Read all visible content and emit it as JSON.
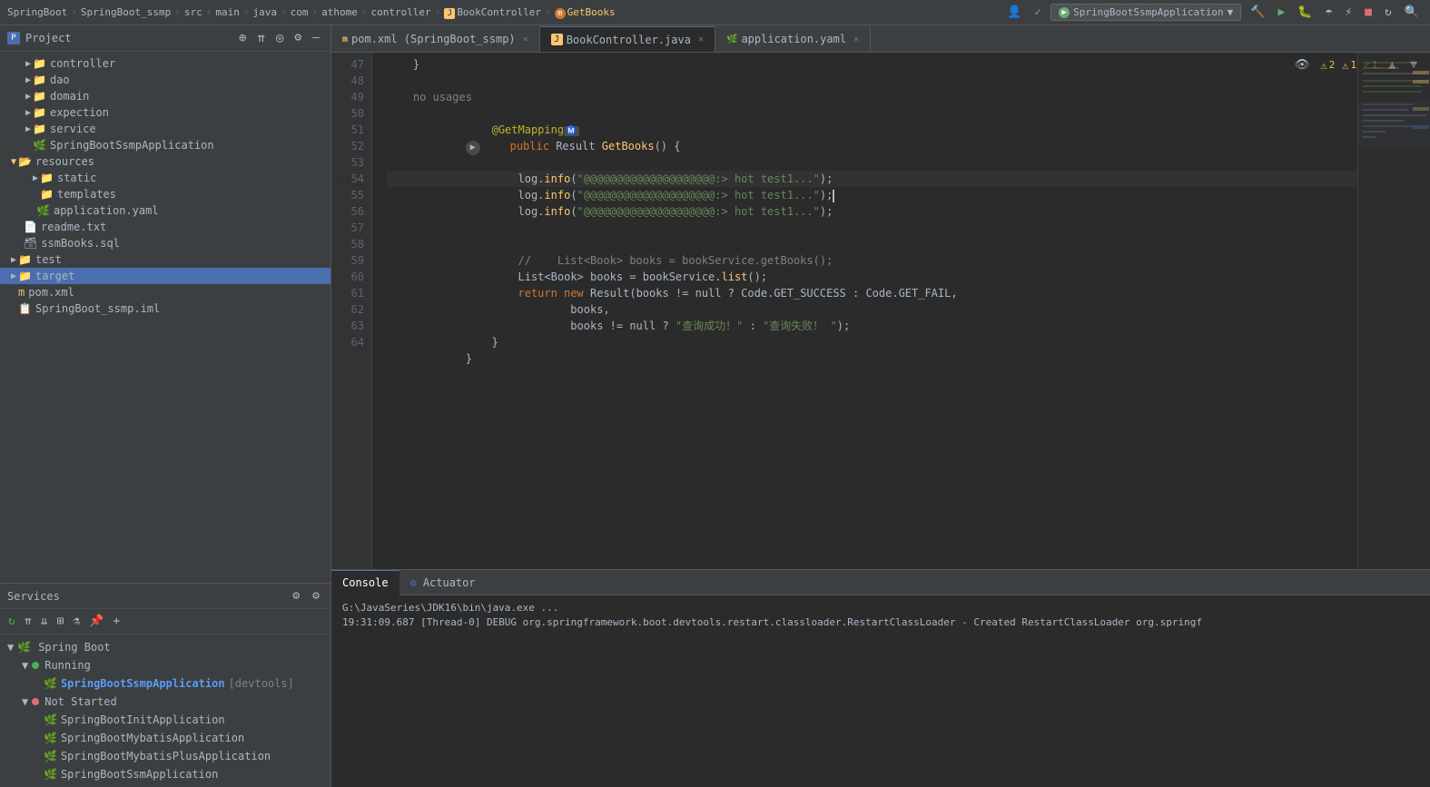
{
  "topbar": {
    "breadcrumb": [
      {
        "label": "SpringBoot",
        "active": false
      },
      {
        "label": "SpringBoot_ssmp",
        "active": false
      },
      {
        "label": "src",
        "active": false
      },
      {
        "label": "main",
        "active": false
      },
      {
        "label": "java",
        "active": false
      },
      {
        "label": "com",
        "active": false
      },
      {
        "label": "athome",
        "active": false
      },
      {
        "label": "controller",
        "active": false
      },
      {
        "label": "BookController",
        "active": false
      },
      {
        "label": "GetBooks",
        "active": true
      }
    ],
    "run_config": "SpringBootSsmpApplication",
    "icons": [
      "hammer",
      "play",
      "debug",
      "coverage",
      "run-configs",
      "search"
    ]
  },
  "sidebar": {
    "title": "Project",
    "tree": [
      {
        "indent": 0,
        "type": "folder",
        "name": "controller",
        "expanded": false
      },
      {
        "indent": 0,
        "type": "folder",
        "name": "dao",
        "expanded": false
      },
      {
        "indent": 0,
        "type": "folder",
        "name": "domain",
        "expanded": false
      },
      {
        "indent": 0,
        "type": "folder",
        "name": "expection",
        "expanded": false
      },
      {
        "indent": 0,
        "type": "folder",
        "name": "service",
        "expanded": false
      },
      {
        "indent": 0,
        "type": "spring",
        "name": "SpringBootSsmpApplication",
        "expanded": false
      },
      {
        "indent": -1,
        "type": "folder-open",
        "name": "resources",
        "expanded": true
      },
      {
        "indent": 0,
        "type": "folder",
        "name": "static",
        "expanded": false
      },
      {
        "indent": 0,
        "type": "folder",
        "name": "templates",
        "expanded": false
      },
      {
        "indent": 0,
        "type": "yaml",
        "name": "application.yaml",
        "expanded": false
      },
      {
        "indent": -1,
        "type": "txt",
        "name": "readme.txt",
        "expanded": false
      },
      {
        "indent": -1,
        "type": "sql",
        "name": "ssmBooks.sql",
        "expanded": false
      },
      {
        "indent": -2,
        "type": "folder",
        "name": "test",
        "expanded": false
      },
      {
        "indent": -2,
        "type": "folder",
        "name": "target",
        "expanded": false,
        "selected": true
      },
      {
        "indent": -2,
        "type": "xml",
        "name": "pom.xml",
        "expanded": false
      },
      {
        "indent": -2,
        "type": "iml",
        "name": "SpringBoot_ssmp.iml",
        "expanded": false
      }
    ]
  },
  "tabs": [
    {
      "label": "pom.xml",
      "icon": "xml",
      "active": false,
      "closable": true,
      "path": "SpringBoot_ssmp"
    },
    {
      "label": "BookController.java",
      "icon": "java",
      "active": true,
      "closable": true,
      "path": ""
    },
    {
      "label": "application.yaml",
      "icon": "yaml",
      "active": false,
      "closable": true,
      "path": ""
    }
  ],
  "editor": {
    "lines": [
      {
        "num": 47,
        "content": "    }",
        "tokens": [
          {
            "text": "    }",
            "cls": "plain"
          }
        ]
      },
      {
        "num": 48,
        "content": "",
        "tokens": []
      },
      {
        "num": 49,
        "content": "    no usages",
        "tokens": [
          {
            "text": "    no usages",
            "cls": "comment"
          }
        ]
      },
      {
        "num": 50,
        "content": "    @GetMappingⓂ️",
        "tokens": [
          {
            "text": "    ",
            "cls": "plain"
          },
          {
            "text": "@GetMapping",
            "cls": "annotation"
          },
          {
            "text": "Ⓜ️",
            "cls": "plain"
          }
        ]
      },
      {
        "num": 51,
        "content": "    public Result GetBooks() {",
        "tokens": [
          {
            "text": "    ",
            "cls": "plain"
          },
          {
            "text": "public",
            "cls": "kw"
          },
          {
            "text": " Result ",
            "cls": "plain"
          },
          {
            "text": "GetBooks",
            "cls": "fn"
          },
          {
            "text": "() {",
            "cls": "plain"
          }
        ]
      },
      {
        "num": 52,
        "content": "",
        "tokens": []
      },
      {
        "num": 53,
        "content": "        log.info(\"@@@@@@@@@@@@@@@@@@@@:> hot test1...\");",
        "tokens": [
          {
            "text": "        log.",
            "cls": "plain"
          },
          {
            "text": "info",
            "cls": "method"
          },
          {
            "text": "(",
            "cls": "plain"
          },
          {
            "text": "\"@@@@@@@@@@@@@@@@@@@@:> hot test1...\"",
            "cls": "str"
          },
          {
            "text": ");",
            "cls": "plain"
          }
        ]
      },
      {
        "num": 54,
        "content": "        log.info(\"@@@@@@@@@@@@@@@@@@@@:> hot test1...\");",
        "tokens": [
          {
            "text": "        log.",
            "cls": "plain"
          },
          {
            "text": "info",
            "cls": "method"
          },
          {
            "text": "(",
            "cls": "plain"
          },
          {
            "text": "\"@@@@@@@@@@@@@@@@@@@@:> hot test1...\"",
            "cls": "str"
          },
          {
            "text": ");",
            "cls": "plain"
          }
        ],
        "current": true
      },
      {
        "num": 55,
        "content": "        log.info(\"@@@@@@@@@@@@@@@@@@@@:> hot test1...\");",
        "tokens": [
          {
            "text": "        log.",
            "cls": "plain"
          },
          {
            "text": "info",
            "cls": "method"
          },
          {
            "text": "(",
            "cls": "plain"
          },
          {
            "text": "\"@@@@@@@@@@@@@@@@@@@@:> hot test1...\"",
            "cls": "str"
          },
          {
            "text": ");",
            "cls": "plain"
          }
        ]
      },
      {
        "num": 56,
        "content": "",
        "tokens": []
      },
      {
        "num": 57,
        "content": "",
        "tokens": []
      },
      {
        "num": 58,
        "content": "        //    List<Book> books = bookService.getBooks();",
        "tokens": [
          {
            "text": "        //    List<Book> books = bookService.getBooks();",
            "cls": "comment"
          }
        ]
      },
      {
        "num": 59,
        "content": "        List<Book> books = bookService.list();",
        "tokens": [
          {
            "text": "        ",
            "cls": "plain"
          },
          {
            "text": "List",
            "cls": "type"
          },
          {
            "text": "<",
            "cls": "plain"
          },
          {
            "text": "Book",
            "cls": "type"
          },
          {
            "text": "> books = bookService.",
            "cls": "plain"
          },
          {
            "text": "list",
            "cls": "method"
          },
          {
            "text": "();",
            "cls": "plain"
          }
        ]
      },
      {
        "num": 60,
        "content": "        return new Result(books != null ? Code.GET_SUCCESS : Code.GET_FAIL,",
        "tokens": [
          {
            "text": "        ",
            "cls": "plain"
          },
          {
            "text": "return",
            "cls": "kw"
          },
          {
            "text": " ",
            "cls": "plain"
          },
          {
            "text": "new",
            "cls": "kw"
          },
          {
            "text": " Result(books != null ? Code.",
            "cls": "plain"
          },
          {
            "text": "GET_SUCCESS",
            "cls": "plain"
          },
          {
            "text": " : Code.",
            "cls": "plain"
          },
          {
            "text": "GET_FAIL",
            "cls": "plain"
          },
          {
            "text": ",",
            "cls": "plain"
          }
        ]
      },
      {
        "num": 61,
        "content": "                books,",
        "tokens": [
          {
            "text": "                books,",
            "cls": "plain"
          }
        ]
      },
      {
        "num": 62,
        "content": "                books != null ? \"查询成功！\" : \"查询失败！ \");",
        "tokens": [
          {
            "text": "                books != null ? ",
            "cls": "plain"
          },
          {
            "text": "\"查询成功！\"",
            "cls": "str"
          },
          {
            "text": " : ",
            "cls": "plain"
          },
          {
            "text": "\"查询失败！ \"",
            "cls": "str"
          },
          {
            "text": ");",
            "cls": "plain"
          }
        ]
      },
      {
        "num": 63,
        "content": "    }",
        "tokens": [
          {
            "text": "    }",
            "cls": "plain"
          }
        ]
      },
      {
        "num": 64,
        "content": "}",
        "tokens": [
          {
            "text": "}",
            "cls": "plain"
          }
        ]
      }
    ],
    "warnings": 2,
    "errors": 1,
    "ok": 1
  },
  "services": {
    "title": "Services",
    "groups": [
      {
        "name": "Spring Boot",
        "expanded": true,
        "items": [
          {
            "name": "Running",
            "expanded": true,
            "status": "running",
            "apps": [
              {
                "name": "SpringBootSsmpApplication",
                "tag": "[devtools]",
                "highlighted": true
              }
            ]
          },
          {
            "name": "Not Started",
            "expanded": true,
            "status": "stopped",
            "apps": [
              {
                "name": "SpringBootInitApplication"
              },
              {
                "name": "SpringBootMybatisApplication"
              },
              {
                "name": "SpringBootMybatisPlusApplication"
              },
              {
                "name": "SpringBootSsmApplication"
              }
            ]
          }
        ]
      }
    ],
    "toolbar_icons": [
      "refresh",
      "collapse-all",
      "expand-all",
      "group",
      "filter",
      "pin",
      "add"
    ]
  },
  "console": {
    "tabs": [
      {
        "label": "Console",
        "active": true
      },
      {
        "label": "Actuator",
        "active": false
      }
    ],
    "lines": [
      {
        "text": "G:\\JavaSeries\\JDK16\\bin\\java.exe ...",
        "cls": "console-path"
      },
      {
        "text": "19:31:09.687 [Thread-0] DEBUG org.springframework.boot.devtools.restart.classloader.RestartClassLoader - Created RestartClassLoader org.springf",
        "cls": "console-debug"
      }
    ]
  }
}
